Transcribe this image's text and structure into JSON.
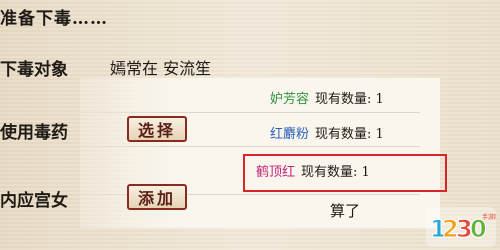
{
  "heading": "准备下毒……",
  "labels": {
    "target": "下毒对象",
    "use_poison": "使用毒药",
    "maid": "内应宫女"
  },
  "target_names": "嫣常在 安流笙",
  "buttons": {
    "select": "选择",
    "add": "添加"
  },
  "poison_list": {
    "items": [
      {
        "name": "妒芳容",
        "count_label": "现有数量:",
        "count": "1",
        "color": "#2e9440"
      },
      {
        "name": "红麝粉",
        "count_label": "现有数量:",
        "count": "1",
        "color": "#2f63b8"
      },
      {
        "name": "鹤顶红",
        "count_label": "现有数量:",
        "count": "1",
        "color": "#c0257a"
      }
    ],
    "cancel": "算了"
  },
  "colors": {
    "highlight": "#d6262c",
    "button_border": "#8a2b20"
  },
  "watermark": "1230手游网"
}
